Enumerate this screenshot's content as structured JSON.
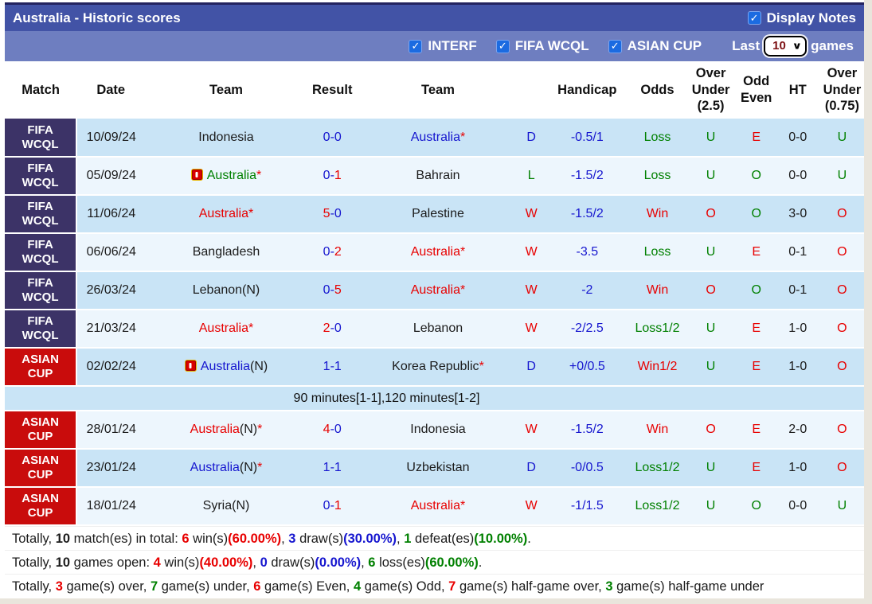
{
  "colors": {
    "titlebar": "#4253a6",
    "filterbar": "#6e7ec0",
    "fifabg": "#3c3367",
    "asianbg": "#c90c0c",
    "rowblue": "#c9e4f6",
    "rowwhite": "#edf6fd",
    "red": "#e80000",
    "green": "#008000",
    "blue": "#1616cf",
    "checkbox": "#1b6be1",
    "selecttext": "#7c1013"
  },
  "icons": {
    "check": "✓",
    "chevron_down": "∨"
  },
  "title_bar": {
    "title": "Australia - Historic scores",
    "display_notes_label": "Display Notes",
    "display_notes_checked": true
  },
  "filter_bar": {
    "checkboxes": [
      "INTERF",
      "FIFA WCQL",
      "ASIAN CUP"
    ],
    "last_label": "Last",
    "games_label": "games",
    "selected_games": "10"
  },
  "table": {
    "headers": [
      "Match",
      "Date",
      "Team",
      "Result",
      "Team",
      "",
      "Handicap",
      "Odds",
      "Over Under (2.5)",
      "Odd Even",
      "HT",
      "Over Under (0.75)"
    ],
    "note": {
      "after_row_index": 6,
      "text": "90 minutes[1-1],120 minutes[1-2]",
      "shade": "blue"
    },
    "rows": [
      {
        "comp": {
          "lines": [
            "FIFA",
            "WCQL"
          ],
          "type": "fifa"
        },
        "date": "10/09/24",
        "home": {
          "icon": false,
          "parts": [
            {
              "t": "Indonesia",
              "c": "dark"
            }
          ]
        },
        "score": [
          {
            "t": "0-0",
            "c": "blue"
          }
        ],
        "away": {
          "icon": false,
          "parts": [
            {
              "t": "Australia",
              "c": "blue"
            },
            {
              "t": "*",
              "c": "red"
            }
          ]
        },
        "letter": {
          "t": "D",
          "c": "blue"
        },
        "handicap": "-0.5/1",
        "odds": {
          "t": "Loss",
          "c": "green"
        },
        "ou25": {
          "t": "U",
          "c": "green"
        },
        "oddeven": {
          "t": "E",
          "c": "red"
        },
        "ht": "0-0",
        "ou075": {
          "t": "U",
          "c": "green"
        },
        "shade": "blue"
      },
      {
        "comp": {
          "lines": [
            "FIFA",
            "WCQL"
          ],
          "type": "fifa"
        },
        "date": "05/09/24",
        "home": {
          "icon": true,
          "parts": [
            {
              "t": "Australia",
              "c": "green"
            },
            {
              "t": "*",
              "c": "red"
            }
          ]
        },
        "score": [
          {
            "t": "0-",
            "c": "blue"
          },
          {
            "t": "1",
            "c": "red"
          }
        ],
        "away": {
          "icon": false,
          "parts": [
            {
              "t": "Bahrain",
              "c": "dark"
            }
          ]
        },
        "letter": {
          "t": "L",
          "c": "green"
        },
        "handicap": "-1.5/2",
        "odds": {
          "t": "Loss",
          "c": "green"
        },
        "ou25": {
          "t": "U",
          "c": "green"
        },
        "oddeven": {
          "t": "O",
          "c": "green"
        },
        "ht": "0-0",
        "ou075": {
          "t": "U",
          "c": "green"
        },
        "shade": "white"
      },
      {
        "comp": {
          "lines": [
            "FIFA",
            "WCQL"
          ],
          "type": "fifa"
        },
        "date": "11/06/24",
        "home": {
          "icon": false,
          "parts": [
            {
              "t": "Australia",
              "c": "red"
            },
            {
              "t": "*",
              "c": "red"
            }
          ]
        },
        "score": [
          {
            "t": "5",
            "c": "red"
          },
          {
            "t": "-0",
            "c": "blue"
          }
        ],
        "away": {
          "icon": false,
          "parts": [
            {
              "t": "Palestine",
              "c": "dark"
            }
          ]
        },
        "letter": {
          "t": "W",
          "c": "red"
        },
        "handicap": "-1.5/2",
        "odds": {
          "t": "Win",
          "c": "red"
        },
        "ou25": {
          "t": "O",
          "c": "red"
        },
        "oddeven": {
          "t": "O",
          "c": "green"
        },
        "ht": "3-0",
        "ou075": {
          "t": "O",
          "c": "red"
        },
        "shade": "blue"
      },
      {
        "comp": {
          "lines": [
            "FIFA",
            "WCQL"
          ],
          "type": "fifa"
        },
        "date": "06/06/24",
        "home": {
          "icon": false,
          "parts": [
            {
              "t": "Bangladesh",
              "c": "dark"
            }
          ]
        },
        "score": [
          {
            "t": "0-",
            "c": "blue"
          },
          {
            "t": "2",
            "c": "red"
          }
        ],
        "away": {
          "icon": false,
          "parts": [
            {
              "t": "Australia",
              "c": "red"
            },
            {
              "t": "*",
              "c": "red"
            }
          ]
        },
        "letter": {
          "t": "W",
          "c": "red"
        },
        "handicap": "-3.5",
        "odds": {
          "t": "Loss",
          "c": "green"
        },
        "ou25": {
          "t": "U",
          "c": "green"
        },
        "oddeven": {
          "t": "E",
          "c": "red"
        },
        "ht": "0-1",
        "ou075": {
          "t": "O",
          "c": "red"
        },
        "shade": "white"
      },
      {
        "comp": {
          "lines": [
            "FIFA",
            "WCQL"
          ],
          "type": "fifa"
        },
        "date": "26/03/24",
        "home": {
          "icon": false,
          "parts": [
            {
              "t": "Lebanon(N)",
              "c": "dark"
            }
          ]
        },
        "score": [
          {
            "t": "0-",
            "c": "blue"
          },
          {
            "t": "5",
            "c": "red"
          }
        ],
        "away": {
          "icon": false,
          "parts": [
            {
              "t": "Australia",
              "c": "red"
            },
            {
              "t": "*",
              "c": "red"
            }
          ]
        },
        "letter": {
          "t": "W",
          "c": "red"
        },
        "handicap": "-2",
        "odds": {
          "t": "Win",
          "c": "red"
        },
        "ou25": {
          "t": "O",
          "c": "red"
        },
        "oddeven": {
          "t": "O",
          "c": "green"
        },
        "ht": "0-1",
        "ou075": {
          "t": "O",
          "c": "red"
        },
        "shade": "blue"
      },
      {
        "comp": {
          "lines": [
            "FIFA",
            "WCQL"
          ],
          "type": "fifa"
        },
        "date": "21/03/24",
        "home": {
          "icon": false,
          "parts": [
            {
              "t": "Australia",
              "c": "red"
            },
            {
              "t": "*",
              "c": "red"
            }
          ]
        },
        "score": [
          {
            "t": "2",
            "c": "red"
          },
          {
            "t": "-0",
            "c": "blue"
          }
        ],
        "away": {
          "icon": false,
          "parts": [
            {
              "t": "Lebanon",
              "c": "dark"
            }
          ]
        },
        "letter": {
          "t": "W",
          "c": "red"
        },
        "handicap": "-2/2.5",
        "odds": {
          "t": "Loss1/2",
          "c": "green"
        },
        "ou25": {
          "t": "U",
          "c": "green"
        },
        "oddeven": {
          "t": "E",
          "c": "red"
        },
        "ht": "1-0",
        "ou075": {
          "t": "O",
          "c": "red"
        },
        "shade": "white"
      },
      {
        "comp": {
          "lines": [
            "ASIAN",
            "CUP"
          ],
          "type": "asian"
        },
        "date": "02/02/24",
        "home": {
          "icon": true,
          "parts": [
            {
              "t": "Australia",
              "c": "blue"
            },
            {
              "t": "(N)",
              "c": "dark"
            }
          ]
        },
        "score": [
          {
            "t": "1-1",
            "c": "blue"
          }
        ],
        "away": {
          "icon": false,
          "parts": [
            {
              "t": "Korea Republic",
              "c": "dark"
            },
            {
              "t": "*",
              "c": "red"
            }
          ]
        },
        "letter": {
          "t": "D",
          "c": "blue"
        },
        "handicap": "+0/0.5",
        "odds": {
          "t": "Win1/2",
          "c": "red"
        },
        "ou25": {
          "t": "U",
          "c": "green"
        },
        "oddeven": {
          "t": "E",
          "c": "red"
        },
        "ht": "1-0",
        "ou075": {
          "t": "O",
          "c": "red"
        },
        "shade": "blue"
      },
      {
        "comp": {
          "lines": [
            "ASIAN",
            "CUP"
          ],
          "type": "asian"
        },
        "date": "28/01/24",
        "home": {
          "icon": false,
          "parts": [
            {
              "t": "Australia",
              "c": "red"
            },
            {
              "t": "(N)",
              "c": "dark"
            },
            {
              "t": "*",
              "c": "red"
            }
          ]
        },
        "score": [
          {
            "t": "4",
            "c": "red"
          },
          {
            "t": "-0",
            "c": "blue"
          }
        ],
        "away": {
          "icon": false,
          "parts": [
            {
              "t": "Indonesia",
              "c": "dark"
            }
          ]
        },
        "letter": {
          "t": "W",
          "c": "red"
        },
        "handicap": "-1.5/2",
        "odds": {
          "t": "Win",
          "c": "red"
        },
        "ou25": {
          "t": "O",
          "c": "red"
        },
        "oddeven": {
          "t": "E",
          "c": "red"
        },
        "ht": "2-0",
        "ou075": {
          "t": "O",
          "c": "red"
        },
        "shade": "white"
      },
      {
        "comp": {
          "lines": [
            "ASIAN",
            "CUP"
          ],
          "type": "asian"
        },
        "date": "23/01/24",
        "home": {
          "icon": false,
          "parts": [
            {
              "t": "Australia",
              "c": "blue"
            },
            {
              "t": "(N)",
              "c": "dark"
            },
            {
              "t": "*",
              "c": "red"
            }
          ]
        },
        "score": [
          {
            "t": "1-1",
            "c": "blue"
          }
        ],
        "away": {
          "icon": false,
          "parts": [
            {
              "t": "Uzbekistan",
              "c": "dark"
            }
          ]
        },
        "letter": {
          "t": "D",
          "c": "blue"
        },
        "handicap": "-0/0.5",
        "odds": {
          "t": "Loss1/2",
          "c": "green"
        },
        "ou25": {
          "t": "U",
          "c": "green"
        },
        "oddeven": {
          "t": "E",
          "c": "red"
        },
        "ht": "1-0",
        "ou075": {
          "t": "O",
          "c": "red"
        },
        "shade": "blue"
      },
      {
        "comp": {
          "lines": [
            "ASIAN",
            "CUP"
          ],
          "type": "asian"
        },
        "date": "18/01/24",
        "home": {
          "icon": false,
          "parts": [
            {
              "t": "Syria(N)",
              "c": "dark"
            }
          ]
        },
        "score": [
          {
            "t": "0-",
            "c": "blue"
          },
          {
            "t": "1",
            "c": "red"
          }
        ],
        "away": {
          "icon": false,
          "parts": [
            {
              "t": "Australia",
              "c": "red"
            },
            {
              "t": "*",
              "c": "red"
            }
          ]
        },
        "letter": {
          "t": "W",
          "c": "red"
        },
        "handicap": "-1/1.5",
        "odds": {
          "t": "Loss1/2",
          "c": "green"
        },
        "ou25": {
          "t": "U",
          "c": "green"
        },
        "oddeven": {
          "t": "O",
          "c": "green"
        },
        "ht": "0-0",
        "ou075": {
          "t": "U",
          "c": "green"
        },
        "shade": "white"
      }
    ]
  },
  "footer": {
    "lines": [
      [
        {
          "t": "Totally, "
        },
        {
          "t": "10",
          "b": 1
        },
        {
          "t": " match(es) in total: "
        },
        {
          "t": "6",
          "c": "red",
          "b": 1
        },
        {
          "t": " win(s)"
        },
        {
          "t": "(60.00%)",
          "c": "red",
          "b": 1
        },
        {
          "t": ", "
        },
        {
          "t": "3",
          "c": "blue",
          "b": 1
        },
        {
          "t": " draw(s)"
        },
        {
          "t": "(30.00%)",
          "c": "blue",
          "b": 1
        },
        {
          "t": ", "
        },
        {
          "t": "1",
          "c": "green",
          "b": 1
        },
        {
          "t": " defeat(es)"
        },
        {
          "t": "(10.00%)",
          "c": "green",
          "b": 1
        },
        {
          "t": "."
        }
      ],
      [
        {
          "t": "Totally, "
        },
        {
          "t": "10",
          "b": 1
        },
        {
          "t": " games open: "
        },
        {
          "t": "4",
          "c": "red",
          "b": 1
        },
        {
          "t": " win(s)"
        },
        {
          "t": "(40.00%)",
          "c": "red",
          "b": 1
        },
        {
          "t": ", "
        },
        {
          "t": "0",
          "c": "blue",
          "b": 1
        },
        {
          "t": " draw(s)"
        },
        {
          "t": "(0.00%)",
          "c": "blue",
          "b": 1
        },
        {
          "t": ", "
        },
        {
          "t": "6",
          "c": "green",
          "b": 1
        },
        {
          "t": " loss(es)"
        },
        {
          "t": "(60.00%)",
          "c": "green",
          "b": 1
        },
        {
          "t": "."
        }
      ],
      [
        {
          "t": "Totally, "
        },
        {
          "t": "3",
          "c": "red",
          "b": 1
        },
        {
          "t": " game(s) over, "
        },
        {
          "t": "7",
          "c": "green",
          "b": 1
        },
        {
          "t": " game(s) under, "
        },
        {
          "t": "6",
          "c": "red",
          "b": 1
        },
        {
          "t": " game(s) Even, "
        },
        {
          "t": "4",
          "c": "green",
          "b": 1
        },
        {
          "t": " game(s) Odd, "
        },
        {
          "t": "7",
          "c": "red",
          "b": 1
        },
        {
          "t": " game(s) half-game over, "
        },
        {
          "t": "3",
          "c": "green",
          "b": 1
        },
        {
          "t": " game(s) half-game under"
        }
      ]
    ]
  }
}
